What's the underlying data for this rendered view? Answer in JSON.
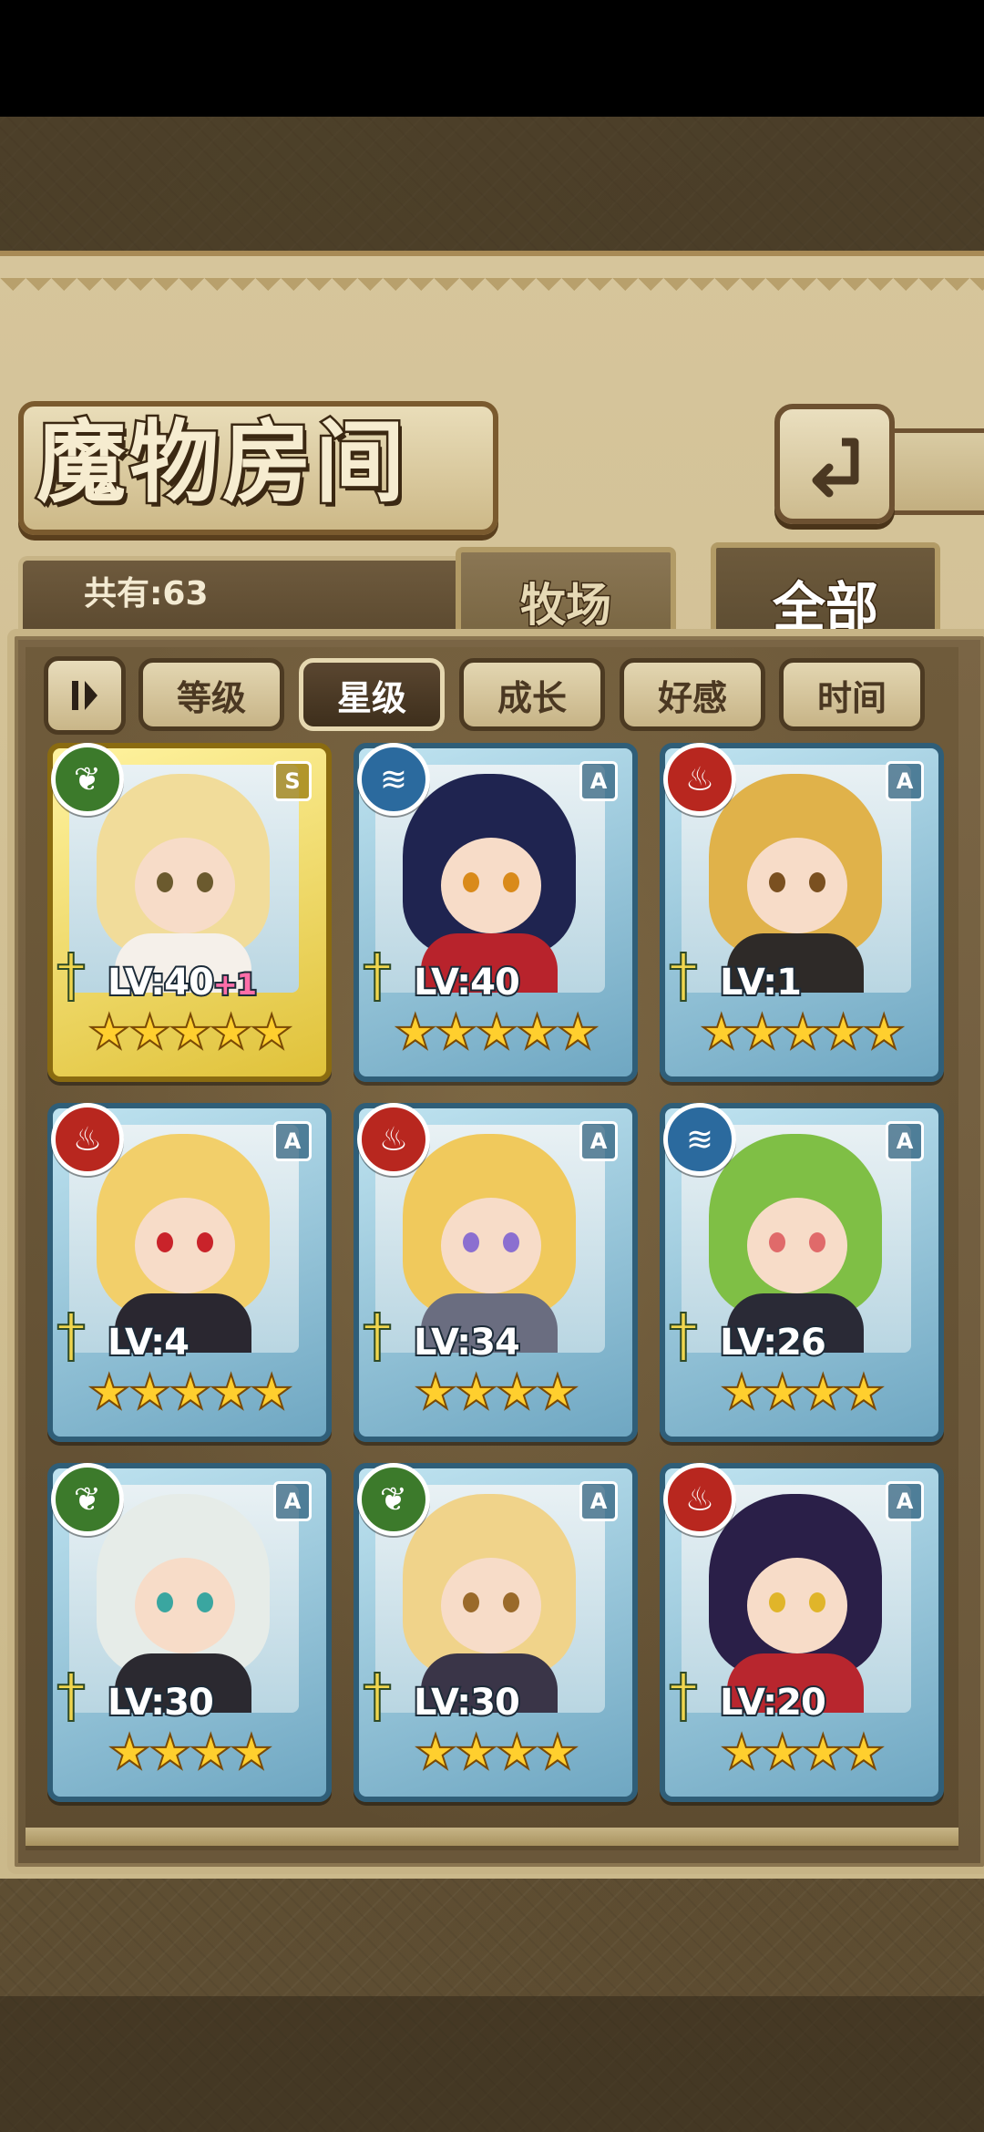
{
  "header": {
    "title": "魔物房间",
    "back_icon": "back-arrow-icon"
  },
  "count": {
    "label": "共有:63"
  },
  "tabs": [
    {
      "label": "牧场",
      "active": false
    },
    {
      "label": "全部",
      "active": true
    }
  ],
  "sort": {
    "toggle_icon": "sort-order-icon",
    "options": [
      {
        "label": "等级",
        "selected": false
      },
      {
        "label": "星级",
        "selected": true
      },
      {
        "label": "成长",
        "selected": false
      },
      {
        "label": "好感",
        "selected": false
      },
      {
        "label": "时间",
        "selected": false
      }
    ]
  },
  "cards": [
    {
      "element": "leaf",
      "rank": "S",
      "level": "LV:40",
      "bonus": "+1",
      "stars": "★★★★★",
      "star_count": 5,
      "hair": "#f1dc9a",
      "eye": "#6b5a2e",
      "body": "#f5f0ea"
    },
    {
      "element": "water",
      "rank": "A",
      "level": "LV:40",
      "bonus": "",
      "stars": "★★★★★",
      "star_count": 5,
      "hair": "#1f2450",
      "eye": "#d98a1a",
      "body": "#b8232c"
    },
    {
      "element": "fire",
      "rank": "A",
      "level": "LV:1",
      "bonus": "",
      "stars": "★★★★★",
      "star_count": 5,
      "hair": "#e0b24a",
      "eye": "#7a5020",
      "body": "#2e2a28"
    },
    {
      "element": "fire",
      "rank": "A",
      "level": "LV:4",
      "bonus": "",
      "stars": "★★★★★",
      "star_count": 5,
      "hair": "#f2cf6a",
      "eye": "#c9232a",
      "body": "#2a2730"
    },
    {
      "element": "fire",
      "rank": "A",
      "level": "LV:34",
      "bonus": "",
      "stars": "★★★★",
      "star_count": 4,
      "hair": "#f0c95c",
      "eye": "#8b6fd0",
      "body": "#6a6d80"
    },
    {
      "element": "water",
      "rank": "A",
      "level": "LV:26",
      "bonus": "",
      "stars": "★★★★",
      "star_count": 4,
      "hair": "#7fbf45",
      "eye": "#e06a6a",
      "body": "#2a2a36"
    },
    {
      "element": "leaf",
      "rank": "A",
      "level": "LV:30",
      "bonus": "",
      "stars": "★★★★",
      "star_count": 4,
      "hair": "#e6ece8",
      "eye": "#3aa6a0",
      "body": "#2b2930"
    },
    {
      "element": "leaf",
      "rank": "A",
      "level": "LV:30",
      "bonus": "",
      "stars": "★★★★",
      "star_count": 4,
      "hair": "#f0d38a",
      "eye": "#9a6a2a",
      "body": "#3a3548"
    },
    {
      "element": "fire",
      "rank": "A",
      "level": "LV:20",
      "bonus": "",
      "stars": "★★★★",
      "star_count": 4,
      "hair": "#2a1f48",
      "eye": "#e0b52a",
      "body": "#b8262e"
    }
  ]
}
